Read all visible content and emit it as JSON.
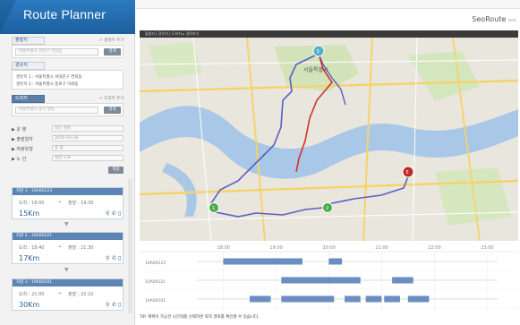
{
  "app": {
    "title": "Route Planner",
    "brand": "SeoRoute",
    "brand_suffix": "beta"
  },
  "breadcrumb": "출발지 | 경유지 | 도착지 ▸ 경로보기",
  "start": {
    "tag": "출발지",
    "link": "+ 출발지 추가",
    "placeholder": "서울특별시 강남구 역삼동",
    "button": "검색"
  },
  "waypoints": {
    "tag": "경유지",
    "items": [
      "경유지 1 : 서울특별시 서대문구 연희동",
      "경유지 2 : 서울특별시 종로구 이화동"
    ]
  },
  "destination": {
    "tag": "도착지",
    "link": "+ 도착지 추가",
    "placeholder": "서울특별시 중구 명동",
    "button": "검색"
  },
  "options": [
    {
      "key": "▶ 운 행",
      "value": "최단 경로"
    },
    {
      "key": "▶ 출발일자",
      "value": "2016-05-18"
    },
    {
      "key": "▶ 차량유형",
      "value": "승 용"
    },
    {
      "key": "▶ 노 선",
      "value": "일반 도로"
    }
  ],
  "apply_button": "적용",
  "vehicles": [
    {
      "id": "차량 1 : 10A00123",
      "depart": "도착 : 18:00",
      "arrive": "출발 : 19:30",
      "distance": "15Km"
    },
    {
      "id": "차량 2 : 10A00121",
      "depart": "도착 : 18:40",
      "arrive": "출발 : 21:30",
      "distance": "17Km"
    },
    {
      "id": "차량 3 : 10A00101",
      "depart": "도착 : 21:00",
      "arrive": "출발 : 22:10",
      "distance": "30Km"
    }
  ],
  "map": {
    "district_label": "서울특별시",
    "markers": [
      "S",
      "1",
      "2",
      "E"
    ]
  },
  "timeline": {
    "times": [
      "18:00",
      "19:00",
      "20:00",
      "21:00",
      "22:00",
      "23:00"
    ],
    "rows": [
      {
        "label": "10A00123",
        "bars": [
          [
            18.0,
            19.5
          ],
          [
            20.0,
            20.25
          ]
        ]
      },
      {
        "label": "10A00121",
        "bars": [
          [
            19.1,
            20.6
          ],
          [
            21.2,
            21.6
          ]
        ]
      },
      {
        "label": "10A00101",
        "bars": [
          [
            18.5,
            18.9
          ],
          [
            19.1,
            20.1
          ],
          [
            20.3,
            20.6
          ],
          [
            20.7,
            21.0
          ],
          [
            21.05,
            21.35
          ],
          [
            21.5,
            21.9
          ]
        ]
      }
    ]
  },
  "footer_note": "TIP. 계획이 가능한 시간대를 선택하면 최적 경로를 확인할 수 있습니다.",
  "colors": {
    "brand": "#2b7bc0",
    "route_blue": "#5b5fc7",
    "route_red": "#d0312d",
    "bar": "#6a8ebf"
  }
}
